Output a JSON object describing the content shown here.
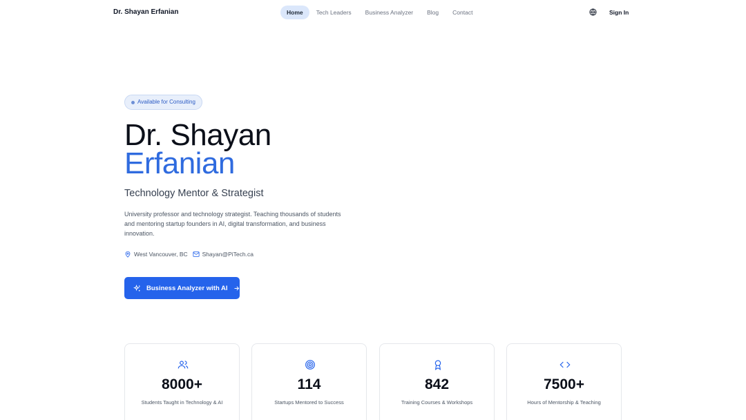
{
  "nav": {
    "brand": "Dr. Shayan Erfanian",
    "links": [
      "Home",
      "Tech Leaders",
      "Business Analyzer",
      "Blog",
      "Contact"
    ],
    "active": "Home",
    "signin": "Sign In",
    "globe_icon": "globe-icon"
  },
  "hero": {
    "badge": "Available for Consulting",
    "name_first": "Dr. Shayan",
    "name_last": "Erfanian",
    "subtitle": "Technology Mentor & Strategist",
    "description": "University professor and technology strategist. Teaching thousands of students and mentoring startup founders in AI, digital transformation, and business innovation.",
    "location": "West Vancouver, BC",
    "email": "Shayan@PiTech.ca",
    "cta": "Business Analyzer with AI"
  },
  "stats": [
    {
      "icon": "users-icon",
      "value": "8000+",
      "label": "Students Taught in Technology & AI"
    },
    {
      "icon": "target-icon",
      "value": "114",
      "label": "Startups Mentored to Success"
    },
    {
      "icon": "award-icon",
      "value": "842",
      "label": "Training Courses & Workshops"
    },
    {
      "icon": "code-icon",
      "value": "7500+",
      "label": "Hours of Mentorship & Teaching"
    }
  ],
  "colors": {
    "accent": "#2563eb",
    "accent_text": "#2f6bdf",
    "badge_bg": "#e8effb"
  }
}
